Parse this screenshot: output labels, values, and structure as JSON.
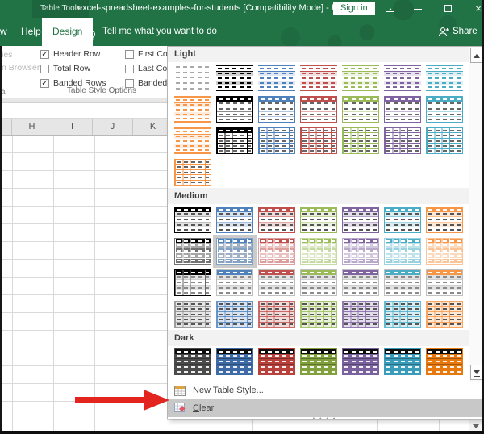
{
  "titlebar": {
    "context_tab": "Table Tools",
    "title": "excel-spreadsheet-examples-for-students  [Compatibility Mode]  -  Ex...",
    "sign_in": "Sign in"
  },
  "tabs": {
    "partial": "w",
    "help": "Help",
    "design": "Design",
    "tellme": "Tell me what you want to do",
    "share": "Share"
  },
  "ribbon": {
    "left_items": [
      "ies",
      "n Browser"
    ],
    "group_tail": "a",
    "options": [
      {
        "label": "Header Row",
        "checked": true
      },
      {
        "label": "Total Row",
        "checked": false
      },
      {
        "label": "Banded Rows",
        "checked": true
      },
      {
        "label": "First Column",
        "checked": false
      },
      {
        "label": "Last Column",
        "checked": false
      },
      {
        "label": "Banded Columns",
        "checked": false
      }
    ],
    "group_label": "Table Style Options"
  },
  "sheet": {
    "columns": [
      "H",
      "I",
      "J",
      "K"
    ]
  },
  "palette": {
    "gray": "#a9a9a9",
    "black": "#000000",
    "blue": "#4f81bd",
    "red": "#c0504d",
    "green": "#9bbb59",
    "purple": "#8064a2",
    "teal": "#4bacc6",
    "orange": "#f79646",
    "darkgray": "#4b4b4b",
    "darkblue": "#3e6ba5",
    "darkred": "#b8413c",
    "darkgreen": "#82a13e",
    "darkpurple": "#7a629e",
    "darkteal": "#3a9cb8",
    "darkorange": "#e8790f",
    "arrow_red": "#e2251f",
    "excel_green": "#217346"
  },
  "gallery": {
    "sections": [
      {
        "name": "Light",
        "rows": [
          [
            {
              "v": "plain",
              "c": "gray"
            },
            {
              "v": "banded",
              "c": "black"
            },
            {
              "v": "banded",
              "c": "blue"
            },
            {
              "v": "banded",
              "c": "red"
            },
            {
              "v": "banded",
              "c": "green"
            },
            {
              "v": "banded",
              "c": "purple"
            },
            {
              "v": "banded",
              "c": "teal"
            }
          ],
          [
            {
              "v": "banded",
              "c": "orange"
            },
            {
              "v": "outline",
              "c": "black"
            },
            {
              "v": "outline",
              "c": "blue"
            },
            {
              "v": "outline",
              "c": "red"
            },
            {
              "v": "outline",
              "c": "green"
            },
            {
              "v": "outline",
              "c": "purple"
            },
            {
              "v": "outline",
              "c": "teal"
            }
          ],
          [
            {
              "v": "banded",
              "c": "orange"
            },
            {
              "v": "grid",
              "c": "black"
            },
            {
              "v": "grid",
              "c": "blue"
            },
            {
              "v": "grid",
              "c": "red"
            },
            {
              "v": "grid",
              "c": "green"
            },
            {
              "v": "grid",
              "c": "purple"
            },
            {
              "v": "grid",
              "c": "teal"
            }
          ],
          [
            {
              "v": "grid",
              "c": "orange"
            }
          ]
        ]
      },
      {
        "name": "Medium",
        "rows": [
          [
            {
              "v": "mheader",
              "c": "black"
            },
            {
              "v": "mheader",
              "c": "blue"
            },
            {
              "v": "mheader",
              "c": "red"
            },
            {
              "v": "mheader",
              "c": "green"
            },
            {
              "v": "mheader",
              "c": "purple"
            },
            {
              "v": "mheader",
              "c": "teal"
            },
            {
              "v": "mheader",
              "c": "orange"
            }
          ],
          [
            {
              "v": "mfull",
              "c": "black"
            },
            {
              "v": "mfull",
              "c": "blue",
              "sel": true
            },
            {
              "v": "mfull",
              "c": "red"
            },
            {
              "v": "mfull",
              "c": "green"
            },
            {
              "v": "mfull",
              "c": "purple"
            },
            {
              "v": "mfull",
              "c": "teal"
            },
            {
              "v": "mfull",
              "c": "orange"
            }
          ],
          [
            {
              "v": "mgray",
              "c": "black"
            },
            {
              "v": "mgray",
              "c": "blue"
            },
            {
              "v": "mgray",
              "c": "red"
            },
            {
              "v": "mgray",
              "c": "green"
            },
            {
              "v": "mgray",
              "c": "purple"
            },
            {
              "v": "mgray",
              "c": "teal"
            },
            {
              "v": "mgray",
              "c": "orange"
            }
          ],
          [
            {
              "v": "mtint",
              "c": "black"
            },
            {
              "v": "mtint",
              "c": "blue"
            },
            {
              "v": "mtint",
              "c": "red"
            },
            {
              "v": "mtint",
              "c": "green"
            },
            {
              "v": "mtint",
              "c": "purple"
            },
            {
              "v": "mtint",
              "c": "teal"
            },
            {
              "v": "mtint",
              "c": "orange"
            }
          ]
        ]
      },
      {
        "name": "Dark",
        "rows": [
          [
            {
              "v": "dark",
              "c": "darkgray"
            },
            {
              "v": "dark",
              "c": "darkblue"
            },
            {
              "v": "dark",
              "c": "darkred"
            },
            {
              "v": "dark",
              "c": "darkgreen"
            },
            {
              "v": "dark",
              "c": "darkpurple"
            },
            {
              "v": "dark",
              "c": "darkteal"
            },
            {
              "v": "dark",
              "c": "darkorange"
            }
          ]
        ]
      }
    ],
    "menu": [
      {
        "mn": "N",
        "rest": "ew Table Style..."
      },
      {
        "mn": "C",
        "rest": "lear"
      }
    ]
  }
}
